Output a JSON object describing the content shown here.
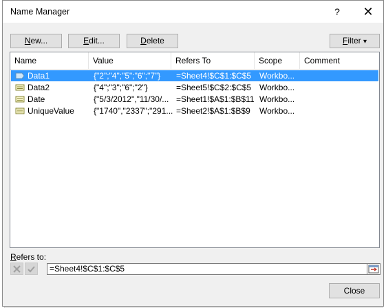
{
  "dialog": {
    "title": "Name Manager",
    "help_label": "?",
    "close_label": "✕"
  },
  "toolbar": {
    "new": {
      "pre": "",
      "accel": "N",
      "post": "ew..."
    },
    "edit": {
      "pre": "",
      "accel": "E",
      "post": "dit..."
    },
    "delete": {
      "pre": "",
      "accel": "D",
      "post": "elete"
    },
    "filter": {
      "pre": "",
      "accel": "F",
      "post": "ilter",
      "arrow": "▾"
    }
  },
  "table": {
    "columns": [
      "Name",
      "Value",
      "Refers To",
      "Scope",
      "Comment"
    ],
    "rows": [
      {
        "name": "Data1",
        "value": "{\"2\";\"4\";\"5\";\"6\";\"7\"}",
        "refers_to": "=Sheet4!$C$1:$C$5",
        "scope": "Workbo...",
        "comment": "",
        "selected": true
      },
      {
        "name": "Data2",
        "value": "{\"4\";\"3\";\"6\";\"2\"}",
        "refers_to": "=Sheet5!$C$2:$C$5",
        "scope": "Workbo...",
        "comment": "",
        "selected": false
      },
      {
        "name": "Date",
        "value": "{\"5/3/2012\",\"11/30/...",
        "refers_to": "=Sheet1!$A$1:$B$11",
        "scope": "Workbo...",
        "comment": "",
        "selected": false
      },
      {
        "name": "UniqueValue",
        "value": "{\"1740\",\"2337\";\"291...",
        "refers_to": "=Sheet2!$A$1:$B$9",
        "scope": "Workbo...",
        "comment": "",
        "selected": false
      }
    ]
  },
  "refers": {
    "label_accel": "R",
    "label_rest": "efers to:",
    "value": "=Sheet4!$C$1:$C$5"
  },
  "footer": {
    "close_label": "Close"
  },
  "colors": {
    "selection": "#3399ff",
    "dialog_bg": "#f0f0f0"
  }
}
